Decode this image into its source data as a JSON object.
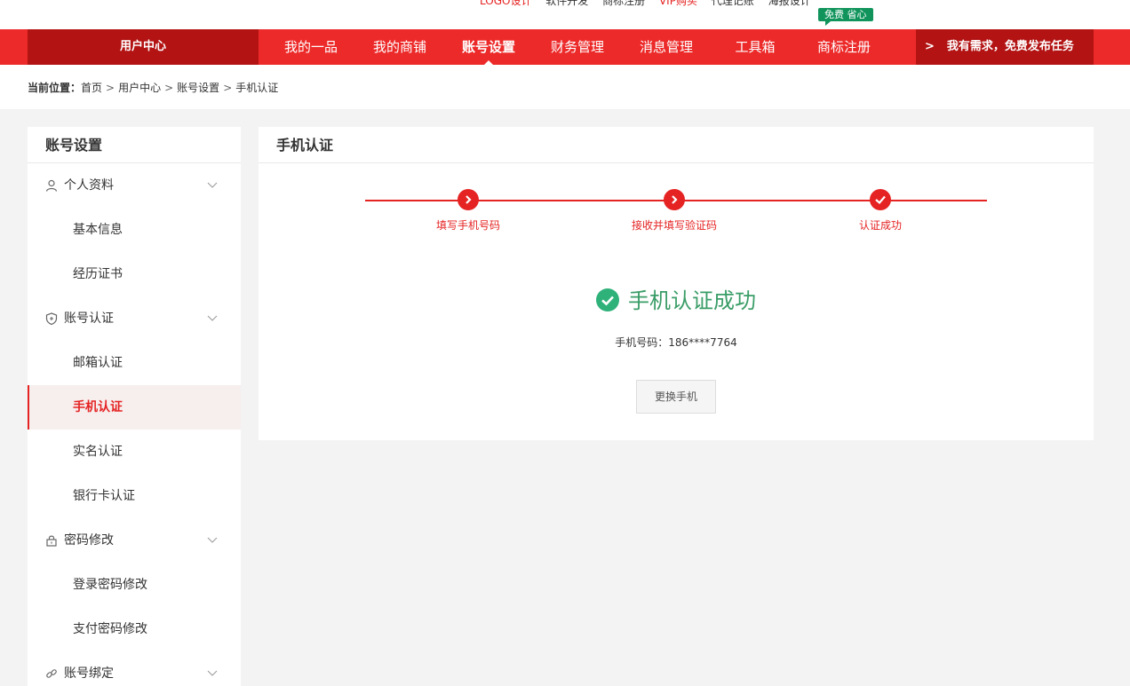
{
  "top_links": [
    {
      "label": "LOGO设计",
      "color": "#e52323"
    },
    {
      "label": "软件开发",
      "color": "#333333"
    },
    {
      "label": "商标注册",
      "color": "#333333"
    },
    {
      "label": "VIP购买",
      "color": "#e52323"
    },
    {
      "label": "代理记账",
      "color": "#333333"
    },
    {
      "label": "海报设计",
      "color": "#333333"
    }
  ],
  "nav": {
    "user_center": "用户中心",
    "items": [
      "我的一品",
      "我的商铺",
      "账号设置",
      "财务管理",
      "消息管理",
      "工具箱",
      "商标注册"
    ],
    "active": "账号设置",
    "badge": "免费 省心",
    "cta_arrow": ">",
    "cta": "我有需求，免费发布任务"
  },
  "breadcrumb": {
    "prefix": "当前位置：",
    "items": [
      "首页",
      "用户中心",
      "账号设置",
      "手机认证"
    ],
    "sep": ">"
  },
  "sidebar": {
    "title": "账号设置",
    "groups": [
      {
        "label": "个人资料",
        "icon": "user-icon",
        "items": [
          "基本信息",
          "经历证书"
        ]
      },
      {
        "label": "账号认证",
        "icon": "shield-icon",
        "items": [
          "邮箱认证",
          "手机认证",
          "实名认证",
          "银行卡认证"
        ]
      },
      {
        "label": "密码修改",
        "icon": "lock-icon",
        "items": [
          "登录密码修改",
          "支付密码修改"
        ]
      },
      {
        "label": "账号绑定",
        "icon": "link-icon",
        "items": []
      }
    ],
    "active_item": "手机认证"
  },
  "main": {
    "title": "手机认证",
    "steps": [
      "填写手机号码",
      "接收并填写验证码",
      "认证成功"
    ],
    "success_text": "手机认证成功",
    "phone_label": "手机号码：",
    "phone_value": "186****7764",
    "change_button": "更换手机"
  },
  "colors": {
    "brand_red": "#ed2a2a",
    "dark_red": "#b31313",
    "success_green": "#3a9d67",
    "badge_green": "#11945c"
  }
}
